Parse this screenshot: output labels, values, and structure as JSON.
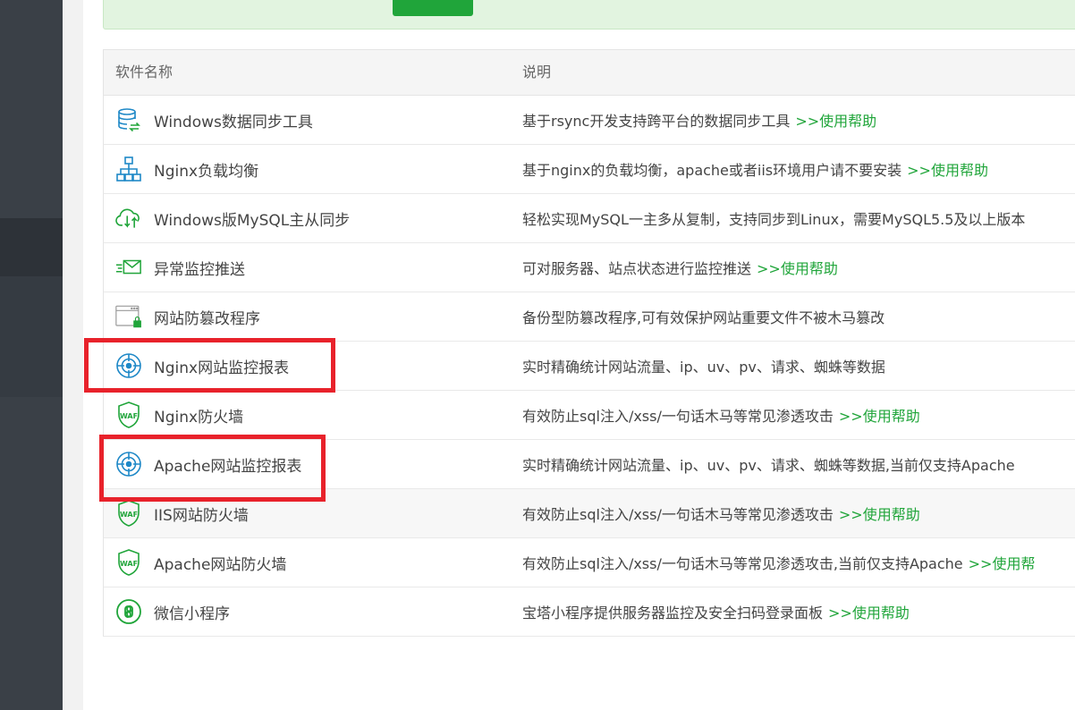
{
  "table": {
    "header": {
      "name": "软件名称",
      "desc": "说明"
    },
    "rows": [
      {
        "name": "Windows数据同步工具",
        "desc": "基于rsync开发支持跨平台的数据同步工具",
        "help": ">>使用帮助",
        "icon": "database-sync-icon"
      },
      {
        "name": "Nginx负载均衡",
        "desc": "基于nginx的负载均衡，apache或者iis环境用户请不要安装",
        "help": ">>使用帮助",
        "icon": "network-tree-icon"
      },
      {
        "name": "Windows版MySQL主从同步",
        "desc": "轻松实现MySQL一主多从复制，支持同步到Linux，需要MySQL5.5及以上版本",
        "help": "",
        "icon": "cloud-sync-icon"
      },
      {
        "name": "异常监控推送",
        "desc": "可对服务器、站点状态进行监控推送",
        "help": ">>使用帮助",
        "icon": "mail-send-icon"
      },
      {
        "name": "网站防篡改程序",
        "desc": "备份型防篡改程序,可有效保护网站重要文件不被木马篡改",
        "help": "",
        "icon": "browser-lock-icon"
      },
      {
        "name": "Nginx网站监控报表",
        "desc": "实时精确统计网站流量、ip、uv、pv、请求、蜘蛛等数据",
        "help": "",
        "icon": "target-icon"
      },
      {
        "name": "Nginx防火墙",
        "desc": "有效防止sql注入/xss/一句话木马等常见渗透攻击",
        "help": ">>使用帮助",
        "icon": "waf-shield-icon"
      },
      {
        "name": "Apache网站监控报表",
        "desc": "实时精确统计网站流量、ip、uv、pv、请求、蜘蛛等数据,当前仅支持Apache",
        "help": "",
        "icon": "target-icon"
      },
      {
        "name": "IIS网站防火墙",
        "desc": "有效防止sql注入/xss/一句话木马等常见渗透攻击",
        "help": ">>使用帮助",
        "icon": "waf-shield-icon"
      },
      {
        "name": "Apache网站防火墙",
        "desc": "有效防止sql注入/xss/一句话木马等常见渗透攻击,当前仅支持Apache",
        "help": ">>使用帮",
        "icon": "waf-shield-icon"
      },
      {
        "name": "微信小程序",
        "desc": "宝塔小程序提供服务器监控及安全扫码登录面板",
        "help": ">>使用帮助",
        "icon": "mini-program-icon"
      }
    ]
  },
  "colors": {
    "accent": "#20a53a",
    "icon_blue": "#1e88c7",
    "highlight": "#e8222b"
  }
}
